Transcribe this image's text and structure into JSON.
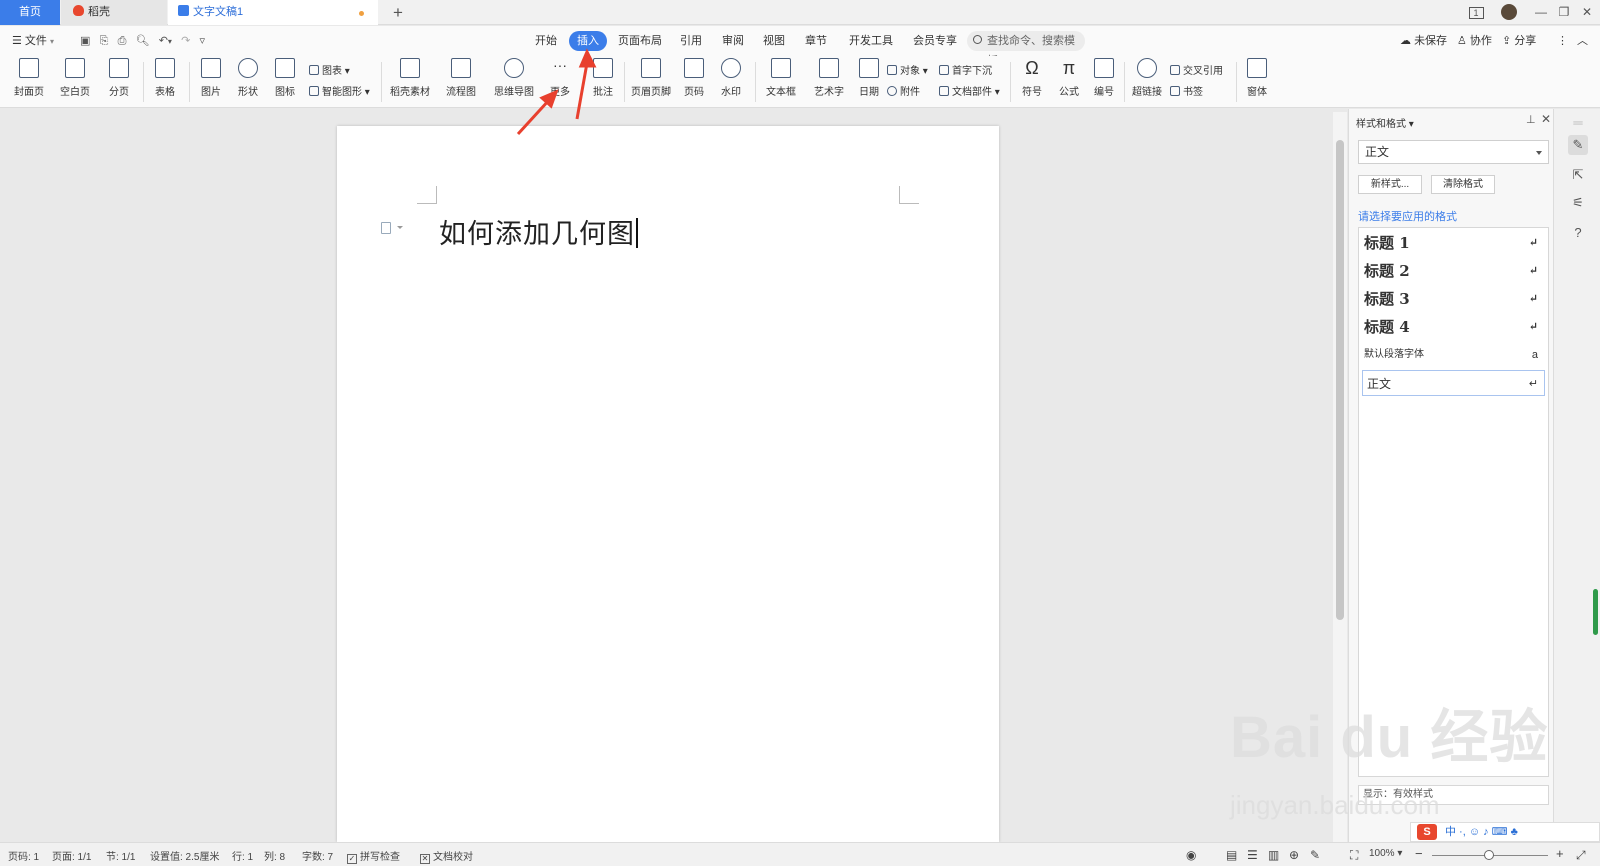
{
  "tabs": {
    "home": "首页",
    "daoke": "稻壳",
    "document": "文字文稿1",
    "new_tab": "+"
  },
  "window": {
    "badge": "1",
    "minimize": "—",
    "restore": "❐",
    "close": "✕"
  },
  "menu": {
    "file": "文件",
    "items": [
      "开始",
      "插入",
      "页面布局",
      "引用",
      "审阅",
      "视图",
      "章节",
      "开发工具",
      "会员专享"
    ],
    "active": "插入",
    "search_placeholder": "查找命令、搜索模板",
    "unsaved": "未保存",
    "collaborate": "协作",
    "share": "分享"
  },
  "ribbon": {
    "cover": "封面页",
    "blank": "空白页",
    "pagebreak": "分页",
    "table": "表格",
    "picture": "图片",
    "shape": "形状",
    "icons": "图标",
    "chart": "图表",
    "smartart": "智能图形",
    "daoke_material": "稻壳素材",
    "flowchart": "流程图",
    "mindmap": "思维导图",
    "more": "更多",
    "comment": "批注",
    "header_footer": "页眉页脚",
    "page_number": "页码",
    "watermark": "水印",
    "textbox": "文本框",
    "wordart": "艺术字",
    "date": "日期",
    "object": "对象",
    "dropcap": "首字下沉",
    "attachment": "附件",
    "doc_parts": "文档部件",
    "symbol": "符号",
    "formula": "公式",
    "numbering": "编号",
    "hyperlink": "超链接",
    "cross_ref": "交叉引用",
    "bookmark": "书签",
    "form": "窗体"
  },
  "document": {
    "title_text": "如何添加几何图"
  },
  "panel": {
    "title": "样式和格式",
    "current_style": "正文",
    "new_style": "新样式...",
    "clear_format": "清除格式",
    "hint": "请选择要应用的格式",
    "styles": [
      {
        "name": "标题  1",
        "mark": "↵"
      },
      {
        "name": "标题  2",
        "mark": "↵"
      },
      {
        "name": "标题  3",
        "mark": "↵"
      },
      {
        "name": "标题  4",
        "mark": "↵"
      },
      {
        "name": "默认段落字体",
        "mark": "a"
      },
      {
        "name": "正文",
        "mark": "↵"
      }
    ],
    "show": "显示：有效样式"
  },
  "status": {
    "page_code": "页码: 1",
    "pages": "页面: 1/1",
    "section": "节: 1/1",
    "setting": "设置值: 2.5厘米",
    "row": "行: 1",
    "col": "列: 8",
    "word_count": "字数: 7",
    "spell_check": "拼写检查",
    "doc_proof": "文档校对",
    "zoom": "100%"
  },
  "ime": {
    "logo": "S",
    "mode": "中 ·, ☺ ♪ ⌨ ♣"
  },
  "watermark": {
    "main": "Bai du 经验",
    "sub": "jingyan.baidu.com"
  },
  "colors": {
    "accent": "#3b7de9",
    "arrow": "#e8402e"
  }
}
